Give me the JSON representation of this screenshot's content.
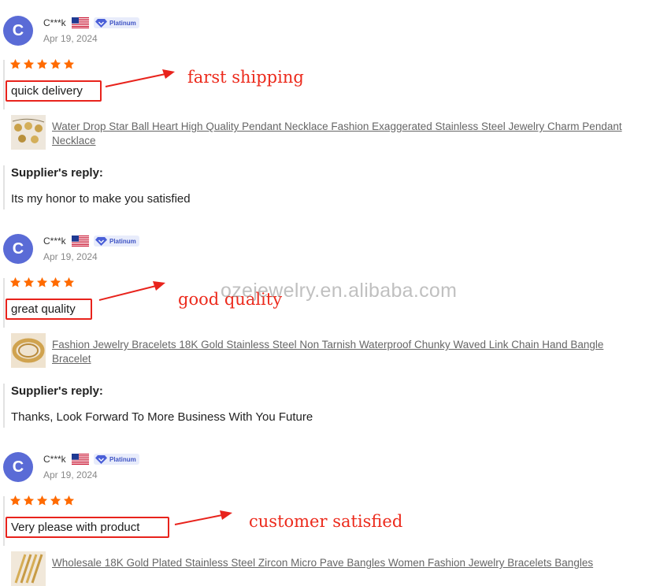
{
  "reviews": [
    {
      "avatar_letter": "C",
      "username": "C***k",
      "badge": "Platinum",
      "date": "Apr 19, 2024",
      "rating": 5,
      "comment": "quick delivery",
      "annotation": "farst shipping",
      "product": "Water Drop Star Ball Heart High Quality Pendant Necklace Fashion Exaggerated Stainless Steel Jewelry Charm Pendant Necklace",
      "reply_title": "Supplier's reply:",
      "reply": "Its my honor to make you satisfied"
    },
    {
      "avatar_letter": "C",
      "username": "C***k",
      "badge": "Platinum",
      "date": "Apr 19, 2024",
      "rating": 5,
      "comment": "great quality",
      "annotation": "good quality",
      "product": "Fashion Jewelry Bracelets 18K Gold Stainless Steel Non Tarnish Waterproof Chunky Waved Link Chain Hand Bangle Bracelet",
      "reply_title": "Supplier's reply:",
      "reply": "Thanks, Look Forward To More Business With You Future"
    },
    {
      "avatar_letter": "C",
      "username": "C***k",
      "badge": "Platinum",
      "date": "Apr 19, 2024",
      "rating": 5,
      "comment": "Very please with product",
      "annotation": "customer satisfied",
      "product": "Wholesale 18K Gold Plated Stainless Steel Zircon Micro Pave Bangles Women Fashion Jewelry Bracelets Bangles",
      "reply_title": "",
      "reply": ""
    }
  ],
  "watermark": "ozejewelry.en.alibaba.com",
  "colors": {
    "avatar": "#5a6bd6",
    "star": "#ff6a00",
    "annotation_red": "#ec2a1c",
    "badge_bg": "#e8ecfb",
    "badge_text": "#3f54c4"
  }
}
